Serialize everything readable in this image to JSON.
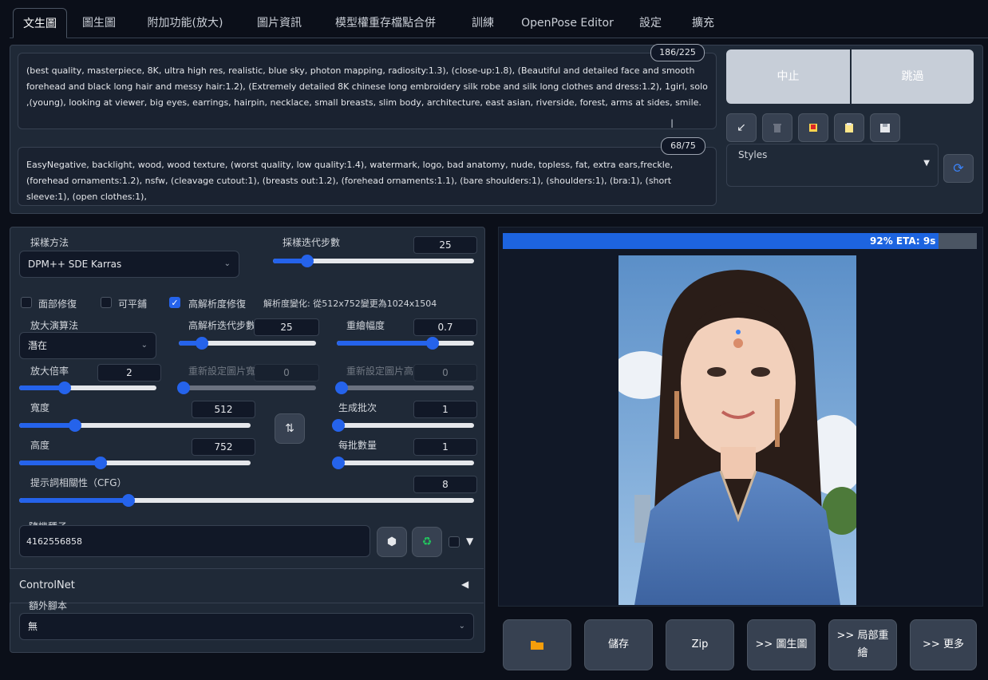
{
  "tabs": [
    "文生圖",
    "圖生圖",
    "附加功能(放大)",
    "圖片資訊",
    "模型權重存檔點合併",
    "訓練",
    "OpenPose Editor",
    "設定",
    "擴充"
  ],
  "prompt": {
    "positive": "(best quality, masterpiece, 8K, ultra high res, realistic, blue sky, photon mapping, radiosity:1.3), (close-up:1.8), (Beautiful and detailed face and smooth forehead and black long hair and messy hair:1.2), (Extremely detailed 8K chinese long embroidery silk robe and silk long clothes and dress:1.2), 1girl, solo ,(young), looking at viewer, big eyes, earrings, hairpin, necklace, small breasts, slim body, architecture, east asian, riverside, forest, arms at sides, smile.",
    "positive_count": "186/225",
    "negative": "EasyNegative, backlight, wood, wood texture, (worst quality, low quality:1.4), watermark, logo, bad anatomy, nude, topless, fat, extra ears,freckle, (forehead ornaments:1.2), nsfw, (cleavage cutout:1), (breasts out:1.2), (forehead ornaments:1.1), (bare shoulders:1), (shoulders:1), (bra:1), (short sleeve:1), (open clothes:1),",
    "negative_count": "68/75"
  },
  "actions": {
    "interrupt": "中止",
    "skip": "跳過"
  },
  "styles": {
    "label": "Styles",
    "value": ""
  },
  "settings": {
    "sampler_label": "採樣方法",
    "sampler_value": "DPM++ SDE Karras",
    "steps_label": "採樣迭代步數",
    "steps_value": "25",
    "steps_fraction": 0.17,
    "restore_faces": "面部修復",
    "tiling": "可平鋪",
    "hires_fix": "高解析度修復",
    "hires_note": "解析度變化: 從512x752變更為1024x1504",
    "upscaler_label": "放大演算法",
    "upscaler_value": "潛在",
    "hires_steps_label": "高解析迭代步數",
    "hires_steps_value": "25",
    "hires_steps_fraction": 0.17,
    "denoise_label": "重繪幅度",
    "denoise_value": "0.7",
    "denoise_fraction": 0.7,
    "upscale_label": "放大倍率",
    "upscale_value": "2",
    "upscale_fraction": 0.33,
    "resize_w_label": "重新設定圖片寬",
    "resize_w_value": "0",
    "resize_h_label": "重新設定圖片高",
    "resize_h_value": "0",
    "width_label": "寬度",
    "width_value": "512",
    "width_fraction": 0.24,
    "height_label": "高度",
    "height_value": "752",
    "height_fraction": 0.35,
    "batch_count_label": "生成批次",
    "batch_count_value": "1",
    "batch_count_fraction": 0.0,
    "batch_size_label": "每批數量",
    "batch_size_value": "1",
    "batch_size_fraction": 0.0,
    "cfg_label": "提示詞相關性（CFG）",
    "cfg_value": "8",
    "cfg_fraction": 0.24,
    "seed_label": "隨機種子",
    "seed_value": "4162556858",
    "controlnet_label": "ControlNet",
    "script_label": "額外腳本",
    "script_value": "無"
  },
  "output": {
    "progress_text": "92% ETA: 9s",
    "progress_fraction": 0.92,
    "buttons": [
      "儲存",
      "Zip",
      ">> 圖生圖",
      ">> 局部重繪",
      ">> 更多"
    ]
  },
  "colors": {
    "accent": "#2563eb",
    "panel": "#1f2937",
    "background": "#0b0f19"
  }
}
